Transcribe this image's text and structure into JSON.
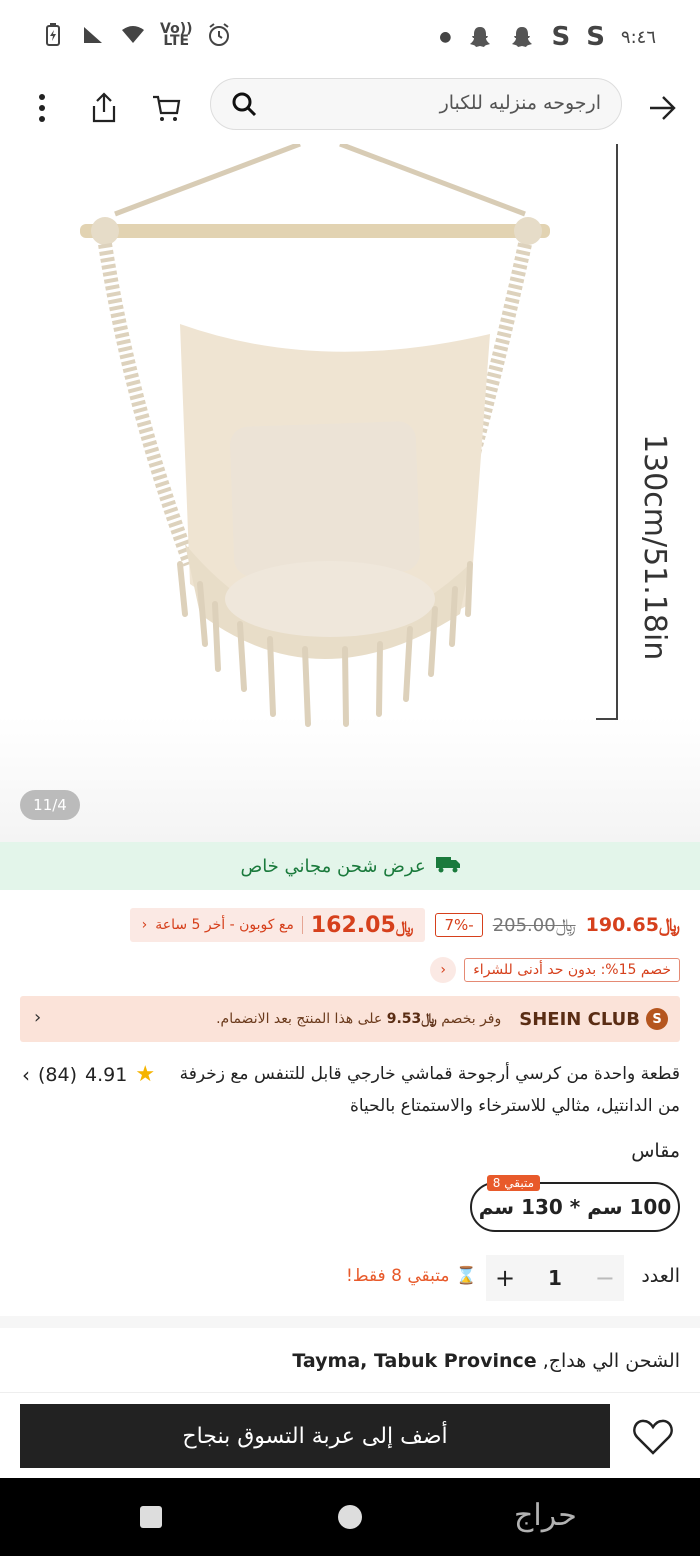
{
  "status_bar": {
    "time": "٩:٤٦",
    "network_label_top": "Vo))",
    "network_label_bottom": "LTE"
  },
  "header": {
    "search_query": "ارجوحه منزليه للكبار"
  },
  "gallery": {
    "dimension_label": "130cm/51.18in",
    "page_indicator": "11/4"
  },
  "shipping_banner": {
    "text": "عرض شحن مجاني خاص"
  },
  "price": {
    "current": "190.65",
    "original": "205.00",
    "discount_pct": "-7%",
    "coupon_price": "162.05",
    "coupon_text": "مع كوبون - أخر 5 ساعة",
    "extra_discount": "خصم 15%: بدون حد أدنى للشراء",
    "currency_symbol": "﷼"
  },
  "club": {
    "name": "SHEIN CLUB",
    "prefix": "وفر بخصم",
    "amount": "9.53",
    "suffix": "على هذا المنتج بعد الانضمام."
  },
  "product": {
    "title": "قطعة واحدة من كرسي أرجوحة قماشي خارجي قابل للتنفس مع زخرفة من الدانتيل، مثالي للاسترخاء والاستمتاع بالحياة",
    "rating": "4.91",
    "review_count": "(84)"
  },
  "size": {
    "label": "مقاس",
    "selected": "100 سم * 130 سم",
    "stock_badge": "متبقي 8"
  },
  "quantity": {
    "label": "العدد",
    "value": "1",
    "remaining": "متبقي 8 فقط!"
  },
  "shipping": {
    "prefix": "الشحن الي هداج,",
    "location": "Tayma, Tabuk Province"
  },
  "actions": {
    "add_to_cart": "أضف إلى عربة التسوق بنجاح"
  },
  "watermark": "حراج",
  "colors": {
    "accent": "#d6401c",
    "green": "#1a7a3c",
    "dark": "#222222"
  }
}
